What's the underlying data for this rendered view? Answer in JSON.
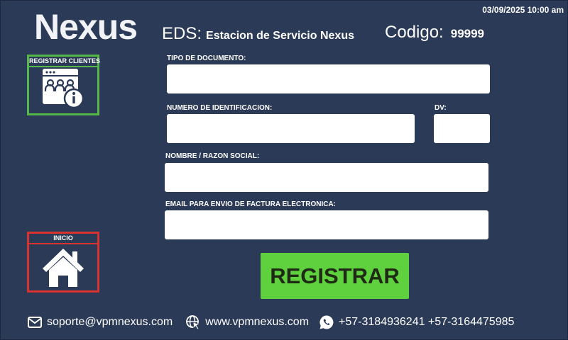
{
  "header": {
    "datetime": "03/09/2025 10:00 am",
    "logo_text": "Nexus",
    "eds_label": "EDS:",
    "eds_value": "Estacion de Servicio Nexus",
    "codigo_label": "Codigo:",
    "codigo_value": "99999"
  },
  "sidebar": {
    "registrar_clientes": {
      "label": "REGISTRAR CLIENTES",
      "icon": "customers-info-icon",
      "color": "#55b848"
    },
    "inicio": {
      "label": "INICIO",
      "icon": "home-icon",
      "color": "#d8322f"
    }
  },
  "form": {
    "tipo_documento": {
      "label": "TIPO DE DOCUMENTO:",
      "value": ""
    },
    "numero_identificacion": {
      "label": "NUMERO DE IDENTIFICACION:",
      "value": ""
    },
    "dv": {
      "label": "DV:",
      "value": ""
    },
    "nombre": {
      "label": "NOMBRE / RAZON SOCIAL:",
      "value": ""
    },
    "email": {
      "label": "EMAIL PARA ENVIO DE FACTURA ELECTRONICA:",
      "value": ""
    },
    "submit_label": "REGISTRAR",
    "submit_color": "#5fd13f"
  },
  "footer": {
    "email": "soporte@vpmnexus.com",
    "website": "www.vpmnexus.com",
    "phones": "+57-3184936241 +57-3164475985"
  },
  "colors": {
    "background": "#2b3a57"
  }
}
